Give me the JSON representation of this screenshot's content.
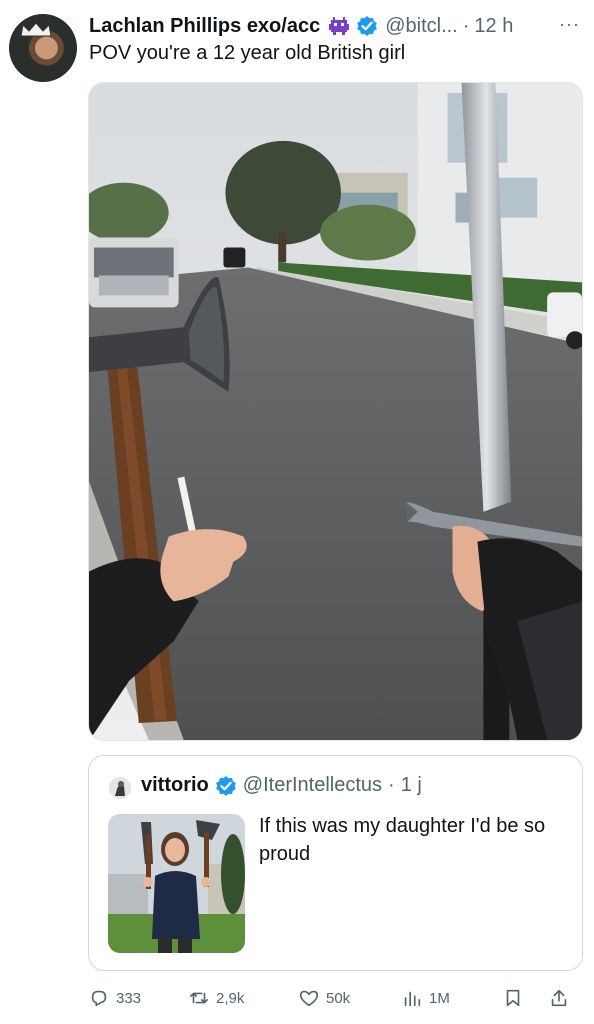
{
  "tweet": {
    "author_name": "Lachlan Phillips exo/acc",
    "author_emoji": "alien-monster-icon",
    "handle": "@bitcl...",
    "separator": "·",
    "time": "12 h",
    "more_label": "···",
    "text": "POV you're a 12 year old British girl"
  },
  "quote": {
    "author_name": "vittorio",
    "handle": "@IterIntellectus",
    "separator": "·",
    "time": "1 j",
    "text": "If this was my daughter I'd be so proud"
  },
  "actions": {
    "replies": "333",
    "retweets": "2,9k",
    "likes": "50k",
    "views": "1M"
  },
  "colors": {
    "text": "#0f1419",
    "secondary": "#536471",
    "verified": "#1d9bf0",
    "border": "#cfd9de"
  }
}
